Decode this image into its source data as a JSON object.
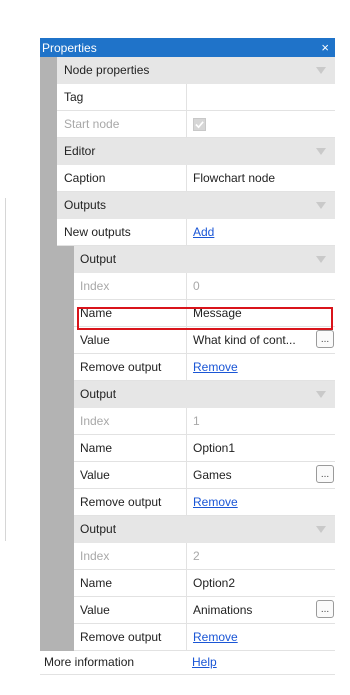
{
  "panel": {
    "title": "Properties",
    "close_glyph": "×"
  },
  "node_properties": {
    "section_label": "Node properties",
    "tag_label": "Tag",
    "tag_value": "",
    "start_node_label": "Start node",
    "start_node_checked": true
  },
  "editor": {
    "section_label": "Editor",
    "caption_label": "Caption",
    "caption_value": "Flowchart node"
  },
  "outputs": {
    "section_label": "Outputs",
    "new_outputs_label": "New outputs",
    "add_link": "Add",
    "items": [
      {
        "section_label": "Output",
        "index_label": "Index",
        "index_value": "0",
        "name_label": "Name",
        "name_value": "Message",
        "value_label": "Value",
        "value_value": "What kind of cont...",
        "remove_label": "Remove output",
        "remove_link": "Remove",
        "dots": "..."
      },
      {
        "section_label": "Output",
        "index_label": "Index",
        "index_value": "1",
        "name_label": "Name",
        "name_value": "Option1",
        "value_label": "Value",
        "value_value": "Games",
        "remove_label": "Remove output",
        "remove_link": "Remove",
        "dots": "..."
      },
      {
        "section_label": "Output",
        "index_label": "Index",
        "index_value": "2",
        "name_label": "Name",
        "name_value": "Option2",
        "value_label": "Value",
        "value_value": "Animations",
        "remove_label": "Remove output",
        "remove_link": "Remove",
        "dots": "..."
      }
    ]
  },
  "footer": {
    "label": "More information",
    "link": "Help"
  },
  "colors": {
    "titlebar": "#1f73c9",
    "gutter": "#b3b3b3",
    "section": "#e6e6e6",
    "link": "#1a56d6",
    "highlight": "#d9141b"
  }
}
